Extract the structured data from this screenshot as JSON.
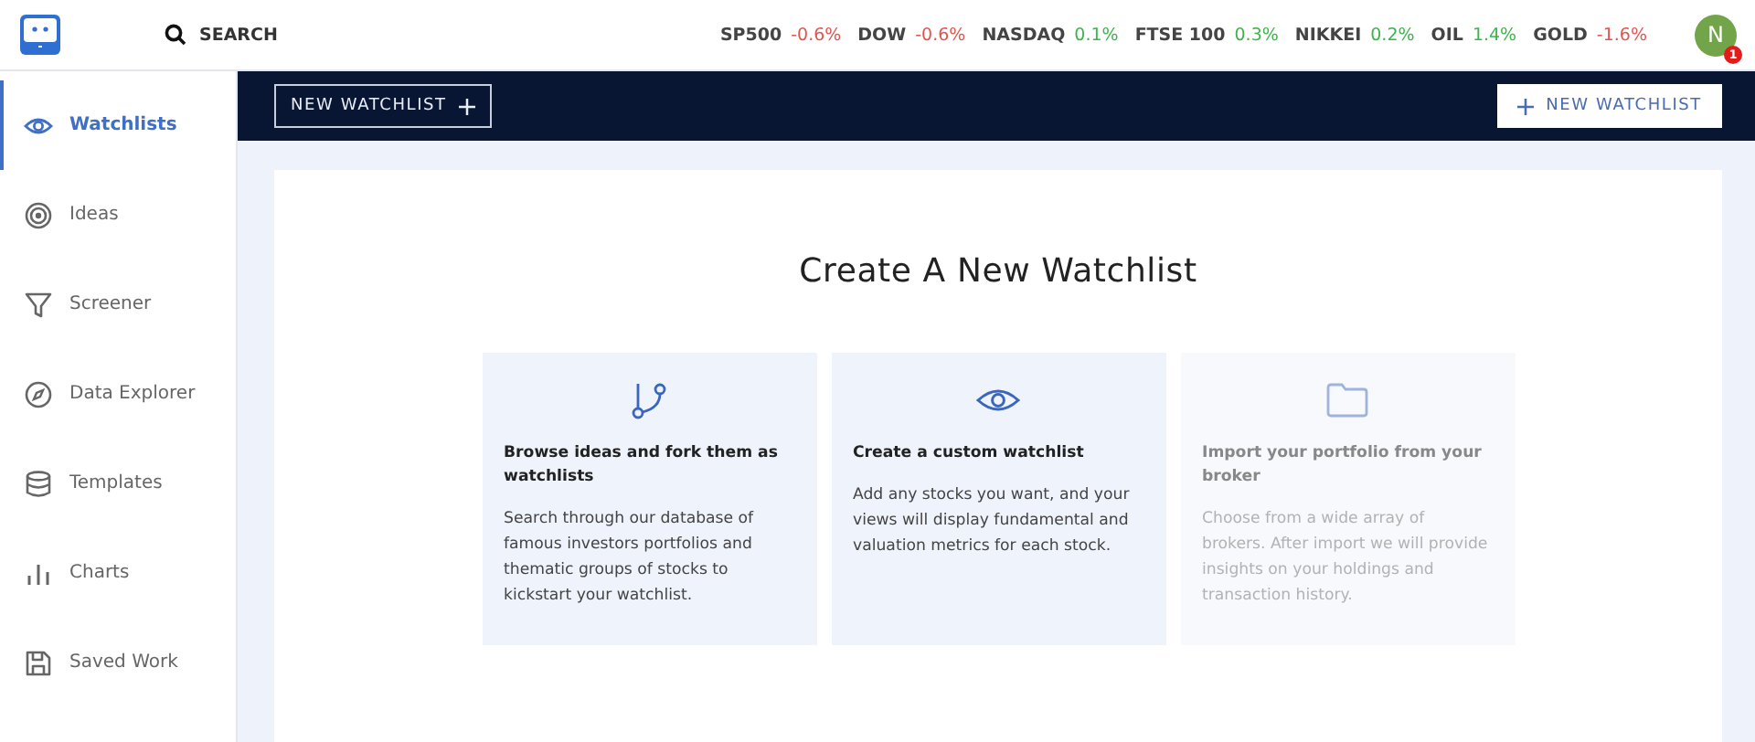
{
  "header": {
    "search_label": "SEARCH",
    "tickers": [
      {
        "name": "SP500",
        "change": "-0.6%",
        "color": "#e0554f"
      },
      {
        "name": "DOW",
        "change": "-0.6%",
        "color": "#e0554f"
      },
      {
        "name": "NASDAQ",
        "change": "0.1%",
        "color": "#3bb54a"
      },
      {
        "name": "FTSE 100",
        "change": "0.3%",
        "color": "#3bb54a"
      },
      {
        "name": "NIKKEI",
        "change": "0.2%",
        "color": "#3bb54a"
      },
      {
        "name": "OIL",
        "change": "1.4%",
        "color": "#3bb54a"
      },
      {
        "name": "GOLD",
        "change": "-1.6%",
        "color": "#e0554f"
      }
    ],
    "avatar": {
      "initial": "N",
      "badge": "1"
    }
  },
  "sidebar": {
    "items": [
      {
        "label": "Watchlists",
        "selected": true
      },
      {
        "label": "Ideas",
        "selected": false
      },
      {
        "label": "Screener",
        "selected": false
      },
      {
        "label": "Data Explorer",
        "selected": false
      },
      {
        "label": "Templates",
        "selected": false
      },
      {
        "label": "Charts",
        "selected": false
      },
      {
        "label": "Saved Work",
        "selected": false
      }
    ]
  },
  "toolbar": {
    "left_button": "NEW WATCHLIST",
    "right_button": "NEW WATCHLIST"
  },
  "main": {
    "title": "Create A New Watchlist",
    "options": [
      {
        "title": "Browse ideas and fork them as watchlists",
        "description": "Search through our database of famous investors portfolios and thematic groups of stocks to kickstart your watchlist.",
        "disabled": false
      },
      {
        "title": "Create a custom watchlist",
        "description": "Add any stocks you want, and your views will display fundamental and valuation metrics for each stock.",
        "disabled": false
      },
      {
        "title": "Import your portfolio from your broker",
        "description": "Choose from a wide array of brokers. After import we will provide insights on your holdings and transaction history.",
        "disabled": true
      }
    ]
  }
}
